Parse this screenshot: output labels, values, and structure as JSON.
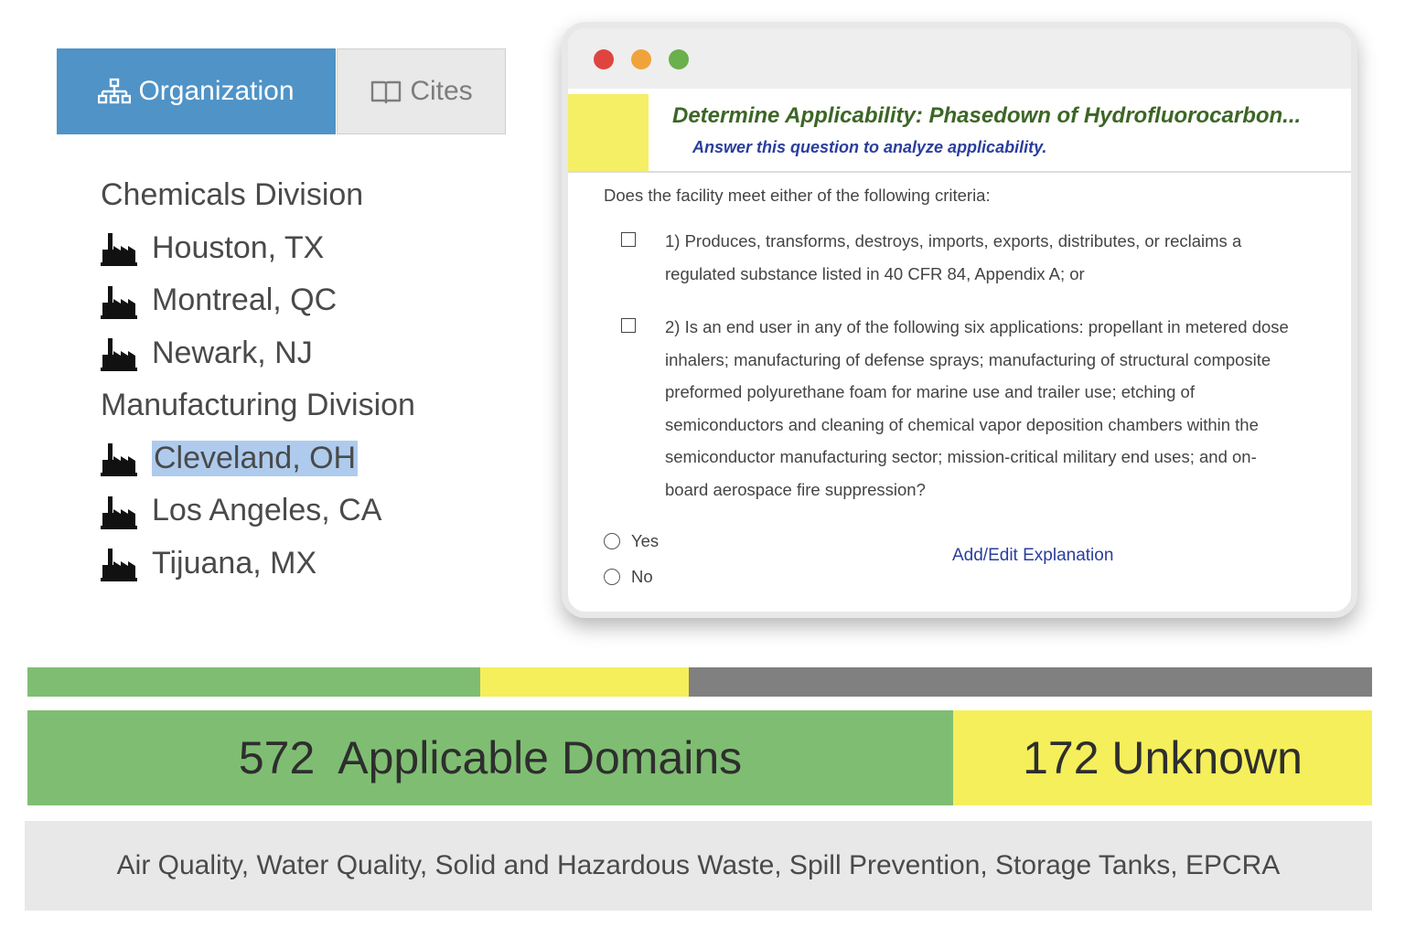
{
  "tabs": {
    "organization": "Organization",
    "cites": "Cites"
  },
  "tree": {
    "divisions": [
      {
        "name": "Chemicals Division",
        "facilities": [
          "Houston, TX",
          "Montreal, QC",
          "Newark, NJ"
        ]
      },
      {
        "name": "Manufacturing Division",
        "facilities": [
          "Cleveland, OH",
          "Los Angeles, CA",
          "Tijuana, MX"
        ]
      }
    ],
    "selected_facility": "Cleveland, OH"
  },
  "question": {
    "title": "Determine Applicability: Phasedown of Hydrofluorocarbon...",
    "subtitle": "Answer this question to analyze applicability.",
    "prompt": "Does the facility meet either of the following criteria:",
    "criteria": [
      "1) Produces, transforms, destroys, imports, exports, distributes, or reclaims a regulated substance listed in 40 CFR 84, Appendix A; or",
      "2) Is an end user in any of the following six applications: propellant in metered dose inhalers; manufacturing of defense sprays; manufacturing of structural composite preformed polyurethane foam for marine use and trailer use; etching of semiconductors and cleaning of chemical vapor deposition chambers within the semiconductor manufacturing sector; mission-critical military end uses; and on-board aerospace fire suppression?"
    ],
    "options": [
      "Yes",
      "No"
    ],
    "explanation_link": "Add/Edit Explanation"
  },
  "progress": {
    "segments": [
      {
        "status": "applicable",
        "fraction": 0.337,
        "color": "#7fbe72"
      },
      {
        "status": "unknown",
        "fraction": 0.155,
        "color": "#f5ef5b"
      },
      {
        "status": "remaining",
        "fraction": 0.508,
        "color": "#808080"
      }
    ]
  },
  "summary": {
    "applicable_text": "572  Applicable Domains",
    "unknown_text": "172 Unknown",
    "domains_text": "Air Quality, Water Quality, Solid and Hazardous Waste, Spill Prevention, Storage Tanks, EPCRA"
  },
  "colors": {
    "tab_active": "#4f93c7",
    "applicable": "#7fbe72",
    "unknown": "#f5ef5b",
    "title_green": "#3c6626",
    "link_blue": "#2a3e9c"
  }
}
